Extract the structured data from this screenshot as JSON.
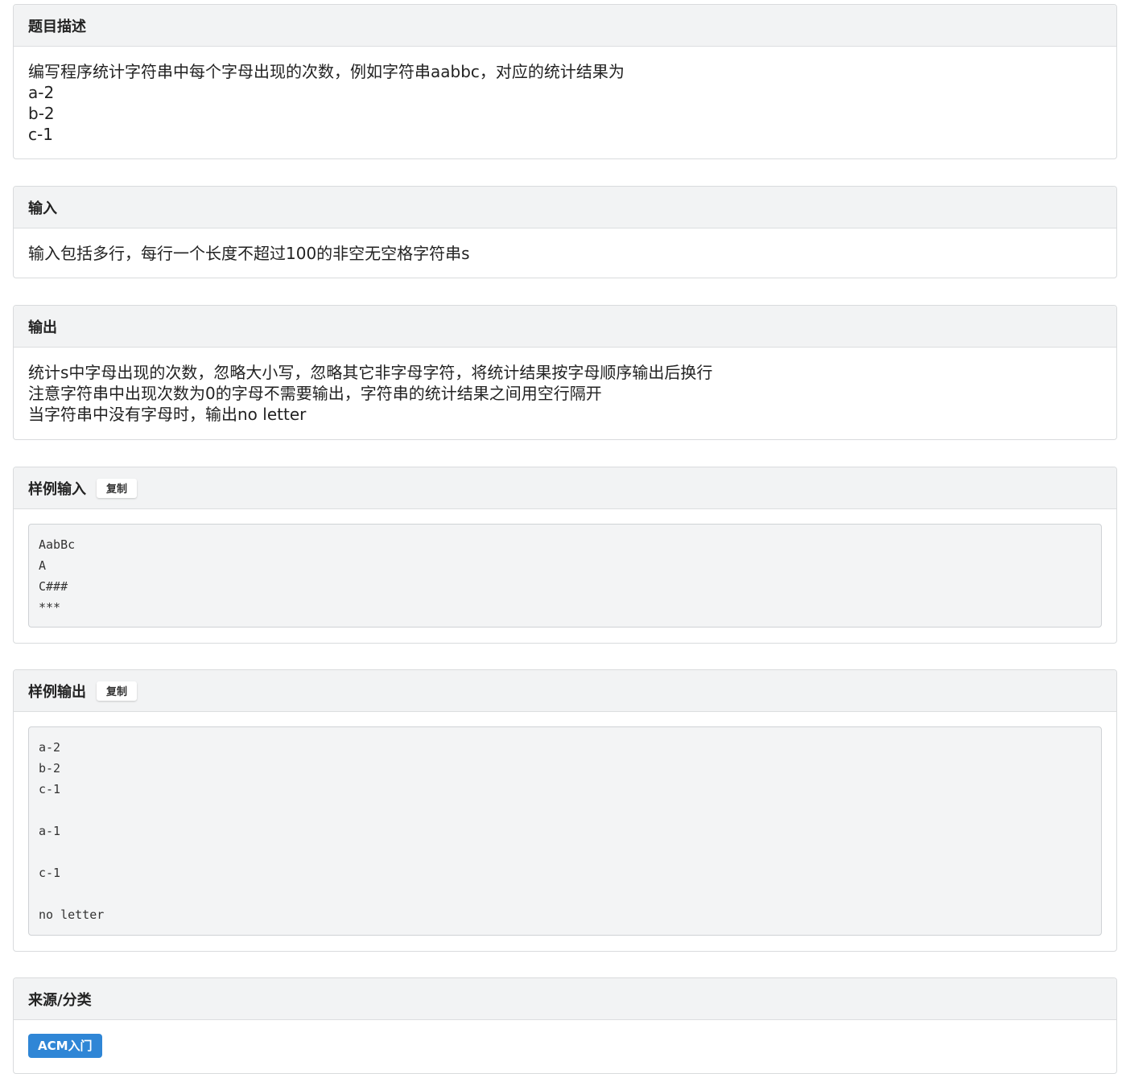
{
  "sections": {
    "description": {
      "title": "题目描述",
      "lines": [
        "编写程序统计字符串中每个字母出现的次数，例如字符串aabbc，对应的统计结果为",
        "a-2",
        "b-2",
        "c-1"
      ]
    },
    "input": {
      "title": "输入",
      "lines": [
        "输入包括多行，每行一个长度不超过100的非空无空格字符串s"
      ]
    },
    "output": {
      "title": "输出",
      "lines": [
        "统计s中字母出现的次数，忽略大小写，忽略其它非字母字符，将统计结果按字母顺序输出后换行",
        "注意字符串中出现次数为0的字母不需要输出，字符串的统计结果之间用空行隔开",
        "当字符串中没有字母时，输出no letter"
      ]
    },
    "sample_input": {
      "title": "样例输入",
      "copy_label": "复制",
      "code": [
        "AabBc",
        "A",
        "C###",
        "***"
      ]
    },
    "sample_output": {
      "title": "样例输出",
      "copy_label": "复制",
      "code": [
        "a-2",
        "b-2",
        "c-1",
        "",
        "a-1",
        "",
        "c-1",
        "",
        "no letter"
      ]
    },
    "source": {
      "title": "来源/分类",
      "tag": "ACM入门"
    }
  },
  "colors": {
    "tag_background": "#2f86d6",
    "header_background": "#f2f3f4",
    "code_background": "#f3f4f5"
  }
}
